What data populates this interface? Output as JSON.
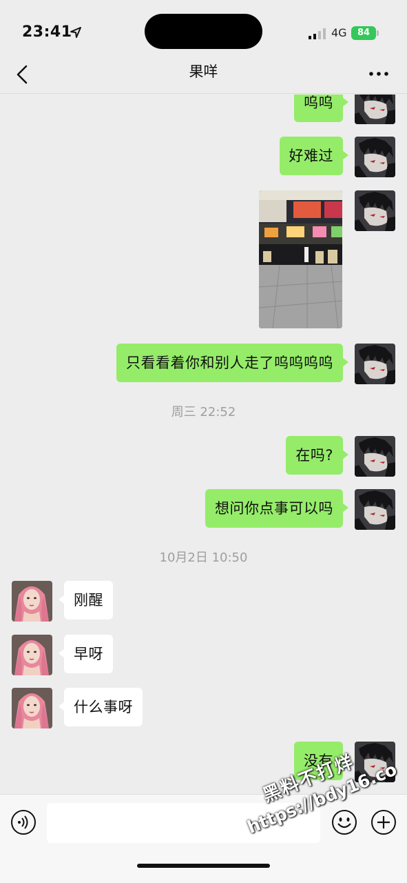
{
  "status": {
    "time": "23:41",
    "network": "4G",
    "battery": "84"
  },
  "nav": {
    "title": "果咩"
  },
  "messages": [
    {
      "side": "me",
      "text": "呜呜"
    },
    {
      "side": "me",
      "text": "好难过"
    },
    {
      "side": "me",
      "type": "image"
    },
    {
      "side": "me",
      "text": "只看看着你和别人走了呜呜呜呜"
    },
    {
      "type": "timestamp",
      "text": "周三 22:52"
    },
    {
      "side": "me",
      "text": "在吗?"
    },
    {
      "side": "me",
      "text": "想问你点事可以吗"
    },
    {
      "type": "timestamp",
      "text": "10月2日 10:50"
    },
    {
      "side": "them",
      "text": "刚醒"
    },
    {
      "side": "them",
      "text": "早呀"
    },
    {
      "side": "them",
      "text": "什么事呀"
    },
    {
      "side": "me",
      "text": "没有"
    }
  ],
  "input": {
    "value": ""
  },
  "watermark": {
    "line1": "黑料不打烊",
    "line2": "https://bdy16.co"
  },
  "colors": {
    "self_bubble": "#95ec69",
    "other_bubble": "#ffffff",
    "background": "#ededed"
  },
  "icons": [
    "location-arrow-icon",
    "back-chevron-icon",
    "more-dots-icon",
    "voice-icon",
    "emoji-icon",
    "plus-icon"
  ]
}
